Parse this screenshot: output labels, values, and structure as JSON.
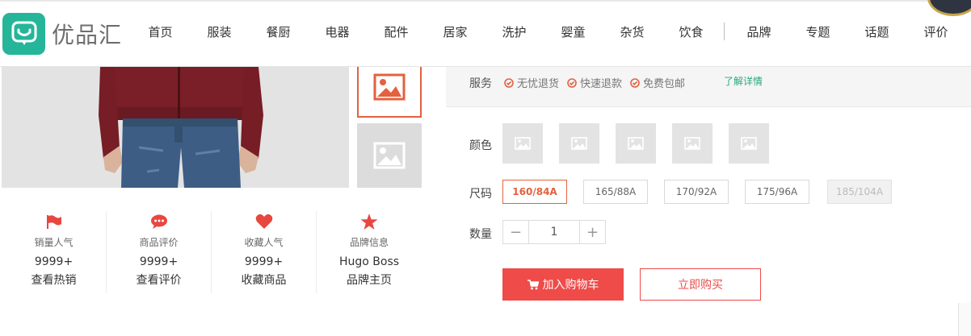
{
  "brand": {
    "name": "优品汇",
    "logo_color": "#25b69a"
  },
  "nav": {
    "primary": [
      "首页",
      "服装",
      "餐厨",
      "电器",
      "配件",
      "居家",
      "洗护",
      "婴童",
      "杂货",
      "饮食"
    ],
    "secondary": [
      "品牌",
      "专题",
      "话题",
      "评价"
    ]
  },
  "gallery": {
    "main_image_icon": "product-photo",
    "thumbnails": [
      {
        "icon": "image-icon",
        "state": "active"
      },
      {
        "icon": "image-icon",
        "state": "inactive"
      }
    ]
  },
  "stats": [
    {
      "icon": "flag-icon",
      "label": "销量人气",
      "value": "9999+",
      "link": "查看热销"
    },
    {
      "icon": "comment-icon",
      "label": "商品评价",
      "value": "9999+",
      "link": "查看评价"
    },
    {
      "icon": "heart-icon",
      "label": "收藏人气",
      "value": "9999+",
      "link": "收藏商品"
    },
    {
      "icon": "star-icon",
      "label": "品牌信息",
      "value": "Hugo Boss",
      "link": "品牌主页"
    }
  ],
  "service": {
    "title": "服务",
    "tags": [
      "无忧退货",
      "快速退款",
      "免费包邮"
    ],
    "more_link": "了解详情"
  },
  "options": {
    "color_label": "颜色",
    "color_swatch_count": 5,
    "size_label": "尺码",
    "sizes": [
      {
        "label": "160/84A",
        "state": "selected"
      },
      {
        "label": "165/88A",
        "state": "normal"
      },
      {
        "label": "170/92A",
        "state": "normal"
      },
      {
        "label": "175/96A",
        "state": "normal"
      },
      {
        "label": "185/104A",
        "state": "disabled"
      }
    ],
    "quantity_label": "数量",
    "quantity_value": "1",
    "minus_glyph": "−",
    "plus_glyph": "+"
  },
  "actions": {
    "add_to_cart": "加入购物车",
    "buy_now": "立即购买"
  },
  "colors": {
    "accent": "#e3613f",
    "danger": "#ef4b49",
    "link_green": "#2aa87c",
    "icon_red": "#e8473f"
  }
}
